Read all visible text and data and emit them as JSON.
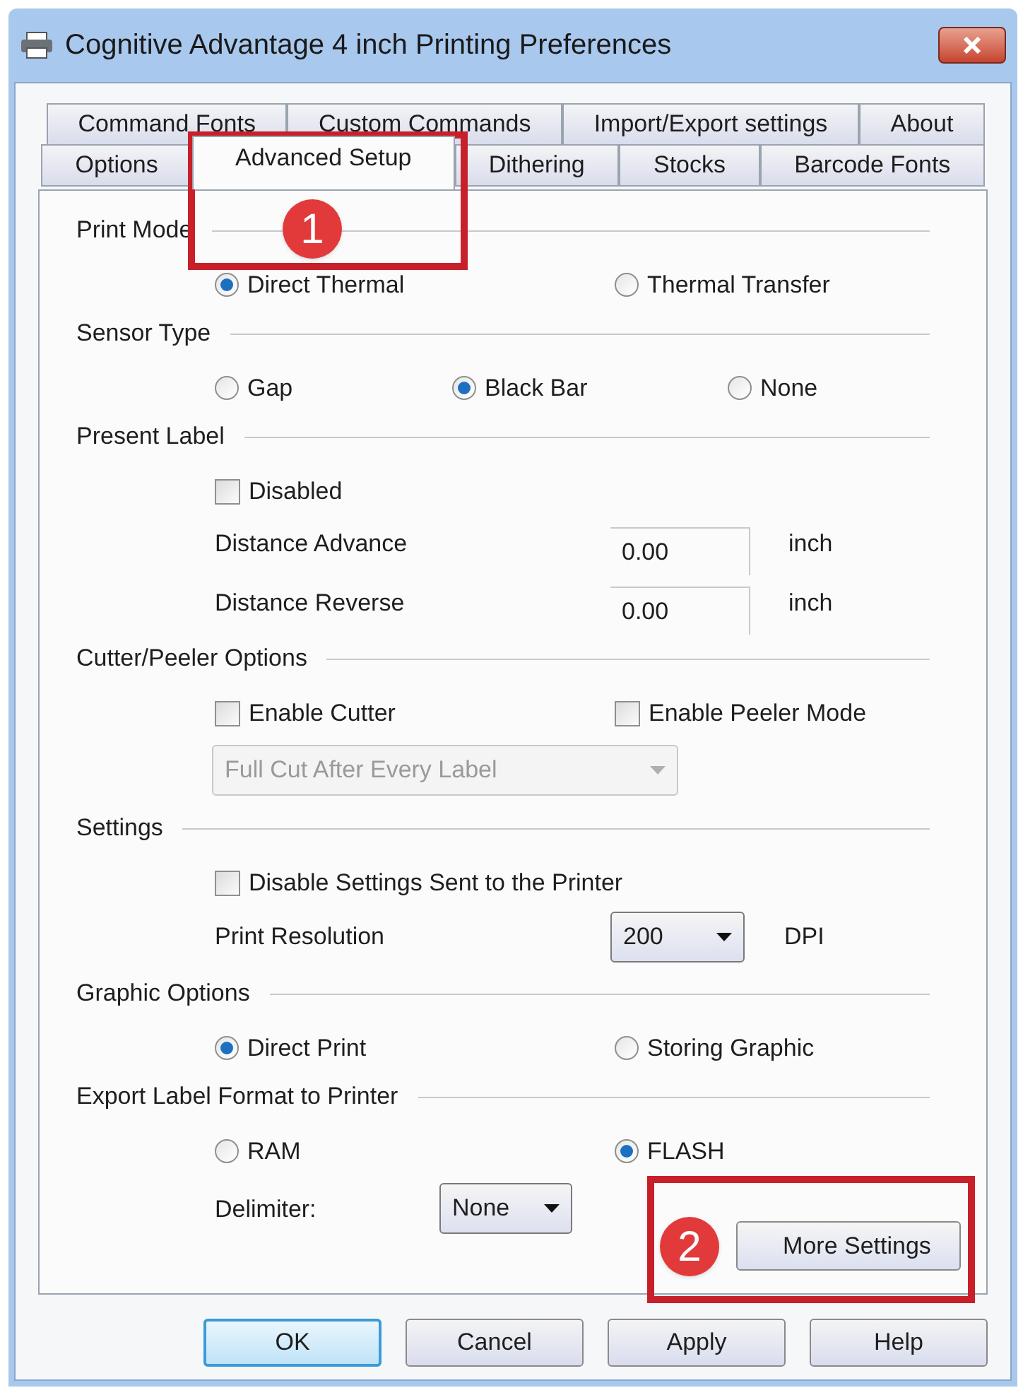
{
  "window": {
    "title": "Cognitive Advantage 4 inch Printing Preferences"
  },
  "tab_rows": [
    [
      {
        "label": "Command Fonts",
        "selected": false
      },
      {
        "label": "Custom Commands",
        "selected": false
      },
      {
        "label": "Import/Export settings",
        "selected": false
      },
      {
        "label": "About",
        "selected": false
      }
    ],
    [
      {
        "label": "Options",
        "selected": false
      },
      {
        "label": "Advanced Setup",
        "selected": true
      },
      {
        "label": "Dithering",
        "selected": false
      },
      {
        "label": "Stocks",
        "selected": false
      },
      {
        "label": "Barcode Fonts",
        "selected": false
      }
    ]
  ],
  "sections": [
    {
      "title": "Print Mode",
      "rows": [
        {
          "kind": "radios",
          "options": [
            {
              "label": "Direct Thermal",
              "selected": true
            },
            {
              "label": "Thermal Transfer",
              "selected": false
            }
          ]
        }
      ]
    },
    {
      "title": "Sensor Type",
      "rows": [
        {
          "kind": "radios",
          "options": [
            {
              "label": "Gap",
              "selected": false
            },
            {
              "label": "Black Bar",
              "selected": true
            },
            {
              "label": "None",
              "selected": false
            }
          ]
        }
      ]
    },
    {
      "title": "Present Label",
      "rows": [
        {
          "kind": "checks",
          "options": [
            {
              "label": "Disabled",
              "checked": false
            }
          ]
        },
        {
          "kind": "field",
          "label": "Distance Advance",
          "value": "0.00",
          "unit": "inch"
        },
        {
          "kind": "field",
          "label": "Distance Reverse",
          "value": "0.00",
          "unit": "inch"
        }
      ]
    },
    {
      "title": "Cutter/Peeler Options",
      "rows": [
        {
          "kind": "checks",
          "options": [
            {
              "label": "Enable Cutter",
              "checked": false
            },
            {
              "label": "Enable Peeler Mode",
              "checked": false
            }
          ]
        },
        {
          "kind": "select",
          "value": "Full Cut After Every Label",
          "disabled": true
        }
      ]
    },
    {
      "title": "Settings",
      "rows": [
        {
          "kind": "checks",
          "options": [
            {
              "label": "Disable Settings Sent to the Printer",
              "checked": false
            }
          ]
        },
        {
          "kind": "select",
          "label": "Print Resolution",
          "value": "200",
          "unit": "DPI",
          "disabled": false
        }
      ]
    },
    {
      "title": "Graphic Options",
      "rows": [
        {
          "kind": "radios",
          "options": [
            {
              "label": "Direct Print",
              "selected": true
            },
            {
              "label": "Storing Graphic",
              "selected": false
            }
          ]
        }
      ]
    },
    {
      "title": "Export Label Format to Printer",
      "rows": [
        {
          "kind": "radios",
          "options": [
            {
              "label": "RAM",
              "selected": false
            },
            {
              "label": "FLASH",
              "selected": true
            }
          ]
        },
        {
          "kind": "select",
          "label": "Delimiter:",
          "value": "None",
          "disabled": false,
          "button": "More Settings"
        }
      ]
    }
  ],
  "buttons": [
    {
      "label": "OK",
      "default": true
    },
    {
      "label": "Cancel",
      "default": false
    },
    {
      "label": "Apply",
      "default": false
    },
    {
      "label": "Help",
      "default": false
    }
  ],
  "callouts": [
    "1",
    "2"
  ]
}
